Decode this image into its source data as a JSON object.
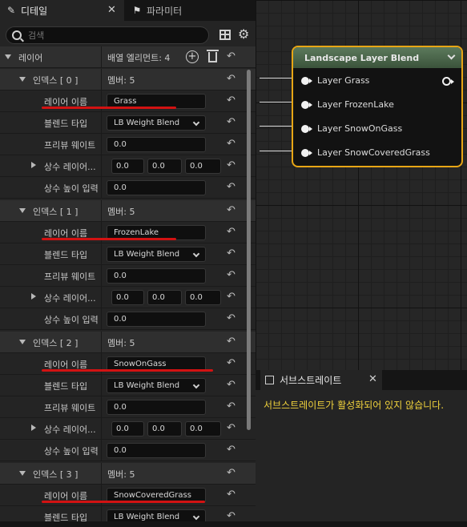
{
  "tabs": {
    "details": "디테일",
    "palette": "파라미터"
  },
  "search": {
    "placeholder": "검색"
  },
  "layers_category": {
    "label": "레이어",
    "value": "배열 엘리먼트: 4"
  },
  "field_labels": {
    "member_count": "멤버: 5",
    "layer_name": "레이어 이름",
    "blend_type": "블렌드 타입",
    "preview_weight": "프리뷰 웨이트",
    "const_layer": "상수 레이어...",
    "const_height": "상수 높이 입력"
  },
  "layers": [
    {
      "index_label": "인덱스 [ 0 ]",
      "name": "Grass",
      "blend_type": "LB Weight Blend",
      "preview_weight": "0.0",
      "const_layer": [
        "0.0",
        "0.0",
        "0.0"
      ],
      "const_height": "0.0"
    },
    {
      "index_label": "인덱스 [ 1 ]",
      "name": "FrozenLake",
      "blend_type": "LB Weight Blend",
      "preview_weight": "0.0",
      "const_layer": [
        "0.0",
        "0.0",
        "0.0"
      ],
      "const_height": "0.0"
    },
    {
      "index_label": "인덱스 [ 2 ]",
      "name": "SnowOnGass",
      "blend_type": "LB Weight Blend",
      "preview_weight": "0.0",
      "const_layer": [
        "0.0",
        "0.0",
        "0.0"
      ],
      "const_height": "0.0"
    },
    {
      "index_label": "인덱스 [ 3 ]",
      "name": "SnowCoveredGrass",
      "blend_type": "LB Weight Blend"
    }
  ],
  "node": {
    "title": "Landscape Layer Blend",
    "pins": [
      "Layer Grass",
      "Layer FrozenLake",
      "Layer SnowOnGass",
      "Layer SnowCoveredGrass"
    ]
  },
  "substrate": {
    "tab_label": "서브스트레이트",
    "message": "서브스트레이트가 활성화되어 있지 않습니다."
  },
  "colors": {
    "node_border": "#e8a615",
    "node_header": "#4d6a4d",
    "annotation_red": "#d21212",
    "warning_text": "#f0d23c"
  }
}
